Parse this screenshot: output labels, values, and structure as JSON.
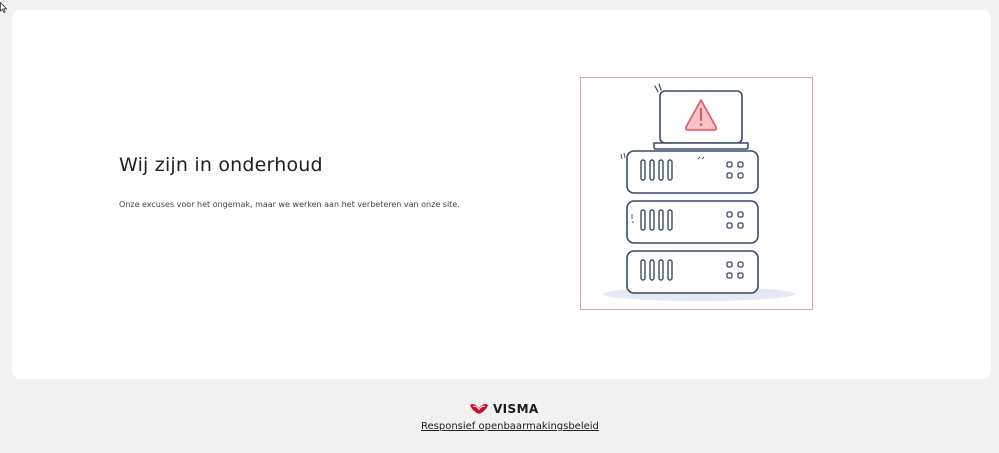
{
  "main": {
    "title": "Wij zijn in onderhoud",
    "description": "Onze excuses voor het ongemak, maar we werken aan het verbeteren van onze site."
  },
  "illustration": {
    "icon": "server-warning-icon",
    "accent_color": "#e05564",
    "line_color": "#3a4a63"
  },
  "footer": {
    "brand": "VISMA",
    "brand_color": "#c8102e",
    "link_text": "Responsief openbaarmakingsbeleid"
  }
}
